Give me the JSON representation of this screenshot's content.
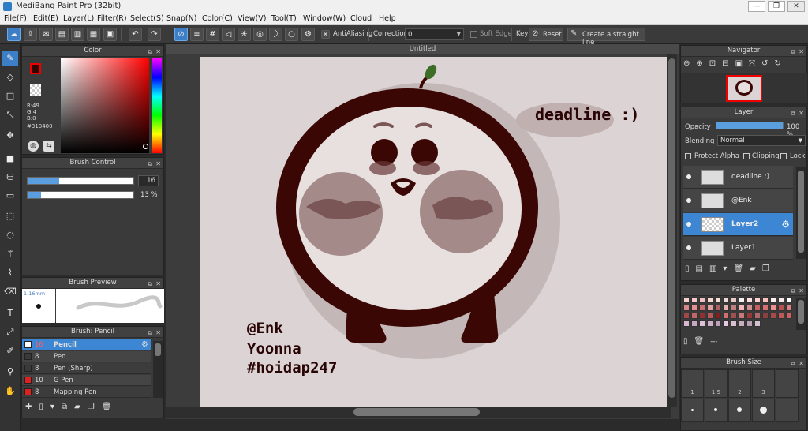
{
  "app": {
    "title": "MediBang Paint Pro (32bit)"
  },
  "window_buttons": [
    "—",
    "❐",
    "✕"
  ],
  "menu": [
    "File(F)",
    "Edit(E)",
    "Layer(L)",
    "Filter(R)",
    "Select(S)",
    "Snap(N)",
    "Color(C)",
    "View(V)",
    "Tool(T)",
    "Window(W)",
    "Cloud",
    "Help"
  ],
  "toolbar": {
    "antialias_label": "AntiAliasing",
    "correction_label": "Correction",
    "correction_value": "0",
    "soft_edge_label": "Soft Edge",
    "key_label": "Key",
    "reset_label": "Reset",
    "straight_line_label": "Create a straight line"
  },
  "color_panel": {
    "title": "Color",
    "r": "R:49",
    "g": "G:4",
    "b": "B:0",
    "hex": "#310400",
    "fg_color": "#310400",
    "bg_color": "#ffffff"
  },
  "brush_control": {
    "title": "Brush Control",
    "size_value": "16",
    "opacity_value": "13 %",
    "size_fill": 0.3,
    "opacity_fill": 0.13
  },
  "brush_preview": {
    "title": "Brush Preview",
    "size_text": "1.16mm"
  },
  "brush_list": {
    "title": "Brush: Pencil",
    "items": [
      {
        "size": "16",
        "name": "Pencil",
        "color": "#ffffff",
        "selected": true
      },
      {
        "size": "8",
        "name": "Pen",
        "color": "#3a3a3a",
        "selected": false
      },
      {
        "size": "8",
        "name": "Pen (Sharp)",
        "color": "#3a3a3a",
        "selected": false
      },
      {
        "size": "10",
        "name": "G Pen",
        "color": "#e02020",
        "selected": false
      },
      {
        "size": "8",
        "name": "Mapping Pen",
        "color": "#e02020",
        "selected": false
      }
    ]
  },
  "canvas": {
    "tab_title": "Untitled",
    "text_bubble": "deadline :)",
    "signature": [
      "@Enk",
      "Yoonna",
      "#hoidap247"
    ]
  },
  "navigator": {
    "title": "Navigator"
  },
  "layer_panel": {
    "title": "Layer",
    "opacity_label": "Opacity",
    "opacity_value": "100 %",
    "opacity_fill": 1.0,
    "blending_label": "Blending",
    "blending_value": "Normal",
    "protect_alpha_label": "Protect Alpha",
    "clipping_label": "Clipping",
    "lock_label": "Lock",
    "layers": [
      {
        "name": "deadline :)",
        "selected": false
      },
      {
        "name": "@Enk",
        "selected": false
      },
      {
        "name": "Layer2",
        "selected": true
      },
      {
        "name": "Layer1",
        "selected": false
      }
    ]
  },
  "palette": {
    "title": "Palette",
    "footer_text": "---",
    "colors": [
      "#f8d0d0",
      "#f8c8c8",
      "#f0c0c0",
      "#f8d8d0",
      "#f8e0d8",
      "#f0d8d8",
      "#e8c8c8",
      "#f8f0f0",
      "#ffe0e0",
      "#ffd0d0",
      "#ffc0c0",
      "#fff0f0",
      "#f8e8e8",
      "#ffffff",
      "#d88888",
      "#e89090",
      "#c87070",
      "#e0a0a0",
      "#b06060",
      "#e8b0b0",
      "#c08080",
      "#f0b8b8",
      "#d09090",
      "#c86060",
      "#d87070",
      "#f09090",
      "#b85050",
      "#e08080",
      "#a04848",
      "#c06868",
      "#903030",
      "#b85858",
      "#802020",
      "#d07070",
      "#a05050",
      "#c87878",
      "#983838",
      "#b06868",
      "#884040",
      "#a84848",
      "#c05858",
      "#d06060",
      "#d8b8d0",
      "#c8a8c0",
      "#e0c0d8",
      "#d0b0c8",
      "#c0a0b8",
      "#e8c8e0",
      "#d8c0d0",
      "#c8b0c0",
      "#b8a0b0",
      "#d0c0d0"
    ]
  },
  "brush_size": {
    "title": "Brush Size",
    "labels": [
      "1",
      "1.5",
      "2",
      "3"
    ]
  }
}
